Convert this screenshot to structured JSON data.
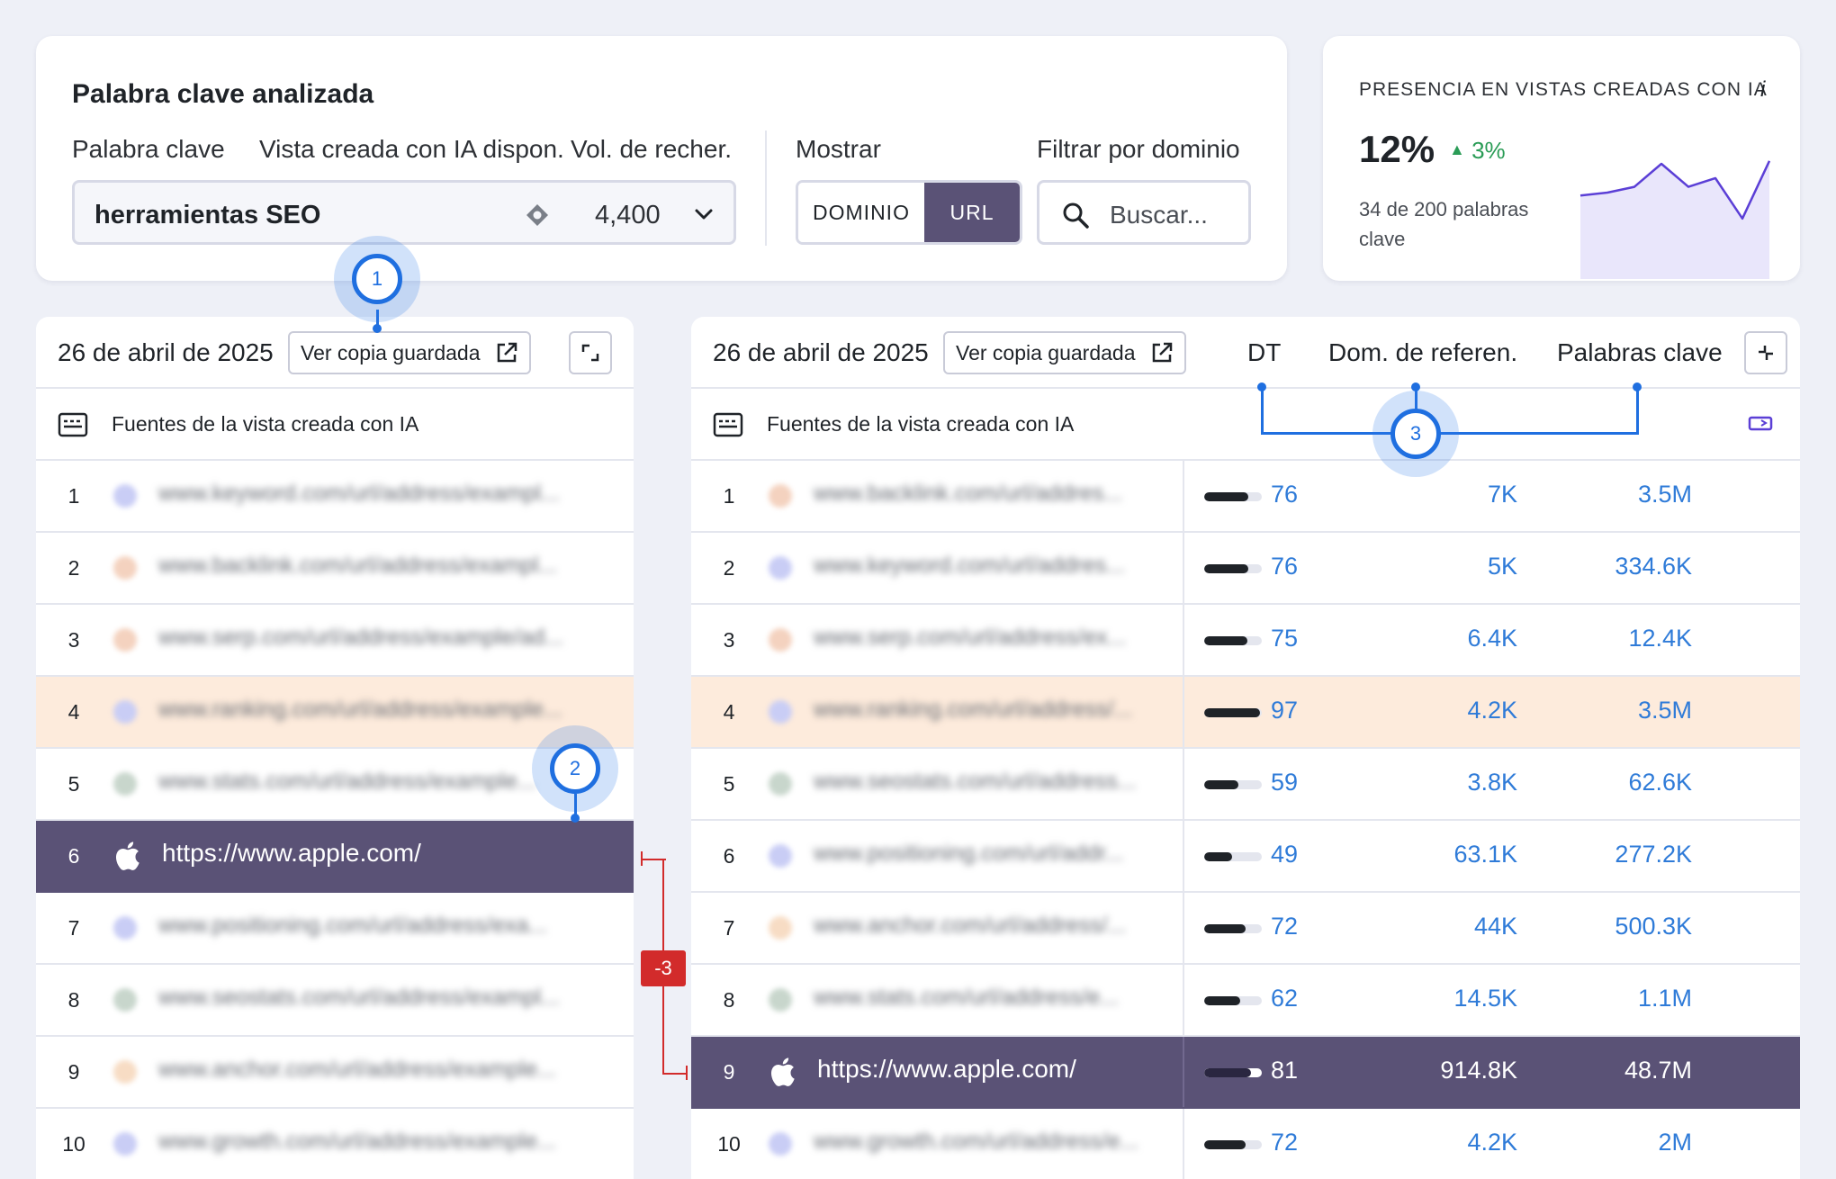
{
  "keyword_card": {
    "title": "Palabra clave analizada",
    "labels": {
      "keyword": "Palabra clave",
      "ai_view": "Vista creada con IA dispon.",
      "volume": "Vol. de recher.",
      "show": "Mostrar",
      "filter": "Filtrar por dominio"
    },
    "keyword_value": "herramientas SEO",
    "volume_value": "4,400",
    "toggle": {
      "domain": "DOMINIO",
      "url": "URL",
      "selected": "URL"
    },
    "search_placeholder": "Buscar..."
  },
  "summary_card": {
    "title": "PRESENCIA EN VISTAS CREADAS CON IA",
    "info": "i",
    "percent": "12%",
    "delta": "3%",
    "subtitle": "34 de 200 palabras clave",
    "sparkline": [
      0.42,
      0.4,
      0.36,
      0.2,
      0.36,
      0.3,
      0.58,
      0.18
    ]
  },
  "left_table": {
    "date": "26 de abril de 2025",
    "save_copy": "Ver copia guardada",
    "sources_header": "Fuentes de la vista creada con IA",
    "rows": [
      {
        "n": "1",
        "url": "www.keyword.com/url/address/exampl...",
        "fav": "#c9cdf5",
        "state": ""
      },
      {
        "n": "2",
        "url": "www.backlink.com/url/address/exampl...",
        "fav": "#f4d2bf",
        "state": ""
      },
      {
        "n": "3",
        "url": "www.serp.com/url/address/example/ad...",
        "fav": "#f4d2bf",
        "state": ""
      },
      {
        "n": "4",
        "url": "www.ranking.com/url/address/example...",
        "fav": "#c9cdf5",
        "state": "hl"
      },
      {
        "n": "5",
        "url": "www.stats.com/url/address/example...",
        "fav": "#c8d6cc",
        "state": ""
      },
      {
        "n": "6",
        "url": "https://www.apple.com/",
        "fav": "",
        "state": "own"
      },
      {
        "n": "7",
        "url": "www.positioning.com/url/address/exa...",
        "fav": "#c9cdf5",
        "state": ""
      },
      {
        "n": "8",
        "url": "www.seostats.com/url/address/exampl...",
        "fav": "#c8d6cc",
        "state": ""
      },
      {
        "n": "9",
        "url": "www.anchor.com/url/address/example...",
        "fav": "#f7dcc4",
        "state": ""
      },
      {
        "n": "10",
        "url": "www.growth.com/url/address/example...",
        "fav": "#c9cdf5",
        "state": ""
      }
    ]
  },
  "right_table": {
    "date": "26 de abril de 2025",
    "save_copy": "Ver copia guardada",
    "sources_header": "Fuentes de la vista creada con IA",
    "columns": {
      "dt": "DT",
      "rd": "Dom. de referen.",
      "kw": "Palabras clave"
    },
    "rows": [
      {
        "n": "1",
        "url": "www.backlink.com/url/addres...",
        "fav": "#f4d2bf",
        "dt": "76",
        "dt_level": 0.76,
        "rd": "7K",
        "kw": "3.5M",
        "state": ""
      },
      {
        "n": "2",
        "url": "www.keyword.com/url/addres...",
        "fav": "#c9cdf5",
        "dt": "76",
        "dt_level": 0.76,
        "rd": "5K",
        "kw": "334.6K",
        "state": ""
      },
      {
        "n": "3",
        "url": "www.serp.com/url/address/ex...",
        "fav": "#f4d2bf",
        "dt": "75",
        "dt_level": 0.75,
        "rd": "6.4K",
        "kw": "12.4K",
        "state": ""
      },
      {
        "n": "4",
        "url": "www.ranking.com/url/address/...",
        "fav": "#c9cdf5",
        "dt": "97",
        "dt_level": 0.97,
        "rd": "4.2K",
        "kw": "3.5M",
        "state": "hl"
      },
      {
        "n": "5",
        "url": "www.seostats.com/url/address...",
        "fav": "#c8d6cc",
        "dt": "59",
        "dt_level": 0.59,
        "rd": "3.8K",
        "kw": "62.6K",
        "state": ""
      },
      {
        "n": "6",
        "url": "www.positioning.com/url/addr...",
        "fav": "#c9cdf5",
        "dt": "49",
        "dt_level": 0.49,
        "rd": "63.1K",
        "kw": "277.2K",
        "state": ""
      },
      {
        "n": "7",
        "url": "www.anchor.com/url/address/...",
        "fav": "#f7dcc4",
        "dt": "72",
        "dt_level": 0.72,
        "rd": "44K",
        "kw": "500.3K",
        "state": ""
      },
      {
        "n": "8",
        "url": "www.stats.com/url/address/e...",
        "fav": "#c8d6cc",
        "dt": "62",
        "dt_level": 0.62,
        "rd": "14.5K",
        "kw": "1.1M",
        "state": ""
      },
      {
        "n": "9",
        "url": "https://www.apple.com/",
        "fav": "",
        "dt": "81",
        "dt_level": 0.81,
        "rd": "914.8K",
        "kw": "48.7M",
        "state": "own"
      },
      {
        "n": "10",
        "url": "www.growth.com/url/address/e...",
        "fav": "#c9cdf5",
        "dt": "72",
        "dt_level": 0.72,
        "rd": "4.2K",
        "kw": "2M",
        "state": ""
      }
    ]
  },
  "annotations": {
    "c1": "1",
    "c2": "2",
    "c3": "3",
    "rank_change": "-3"
  },
  "colors": {
    "accent": "#5a5276",
    "link": "#2f7bd8",
    "highlight": "#fdebdc",
    "callout": "#1f6fe0",
    "positive": "#2a9c56",
    "negative": "#d22b2b"
  }
}
